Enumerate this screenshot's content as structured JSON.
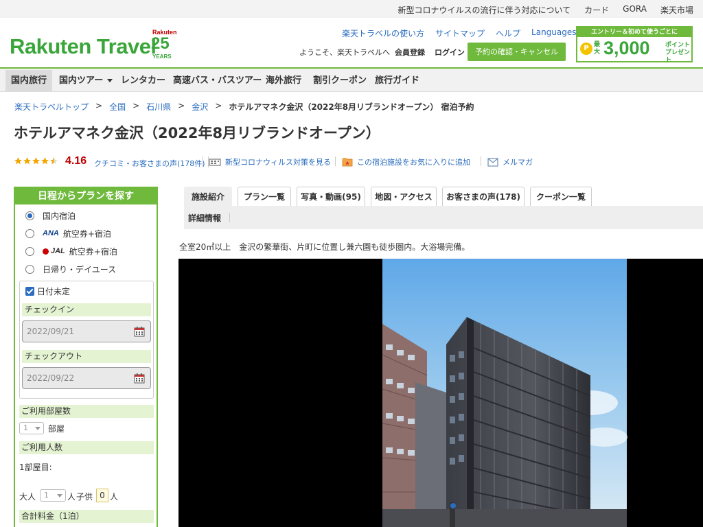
{
  "topbar": {
    "links": [
      "新型コロナウイルスの流行に伴う対応について",
      "カード",
      "GORA",
      "楽天市場"
    ]
  },
  "header": {
    "logo_text": "Rakuten Travel",
    "anniv_brand": "Rakuten",
    "anniv_number": "25",
    "anniv_years": "YEARS",
    "links": [
      "楽天トラベルの使い方",
      "サイトマップ",
      "ヘルプ",
      "Languages"
    ],
    "welcome": "ようこそ、楽天トラベルへ",
    "member_register": "会員登録",
    "login": "ログイン",
    "reserve_button": "予約の確認・キャンセル",
    "promo": {
      "headline": "エントリー＆初めて使うごとに",
      "coin": "P",
      "max": "最大",
      "amount": "3,000",
      "unit": "ポイントプレゼント"
    }
  },
  "nav": {
    "items": [
      "国内旅行",
      "国内ツアー",
      "レンタカー",
      "高速バス・バスツアー",
      "海外旅行",
      "割引クーポン",
      "旅行ガイド"
    ],
    "active": "国内旅行"
  },
  "breadcrumb": {
    "items": [
      "楽天トラベルトップ",
      "全国",
      "石川県",
      "金沢"
    ],
    "separator": ">",
    "current": "ホテルアマネク金沢（2022年8月リブランドオープン） 宿泊予約"
  },
  "hotel": {
    "title": "ホテルアマネク金沢（2022年8月リブランドオープン）",
    "rating": "4.16",
    "rating_value": 4.16,
    "reviews_link": "クチコミ・お客さまの声(178件)",
    "covid_link": "新型コロナウィルス対策を見る",
    "favorite_link": "この宿泊施設をお気に入りに追加",
    "mail_link": "メルマガ",
    "description": "全室20㎡以上　金沢の繁華街、片町に位置し兼六園も徒歩圏内。大浴場完備。"
  },
  "sidebar": {
    "header": "日程からプランを探す",
    "options": [
      {
        "airline": "",
        "label": "国内宿泊",
        "selected": true
      },
      {
        "airline": "ANA",
        "label": "航空券+宿泊",
        "selected": false
      },
      {
        "airline": "JAL",
        "label": "航空券+宿泊",
        "selected": false
      },
      {
        "airline": "",
        "label": "日帰り・デイユース",
        "selected": false
      }
    ],
    "date_undecided": "日付未定",
    "checkin_label": "チェックイン",
    "checkin_value": "2022/09/21",
    "checkout_label": "チェックアウト",
    "checkout_value": "2022/09/22",
    "rooms_label": "ご利用部屋数",
    "rooms_value": "1",
    "rooms_unit": "部屋",
    "guests_label": "ご利用人数",
    "room1_label": "1部屋目:",
    "adult_label": "大人",
    "adult_value": "1",
    "adult_unit": "人",
    "child_label": "子供",
    "child_value": "0",
    "child_unit": "人",
    "total_label": "合計料金（1泊）"
  },
  "tabs": {
    "items": [
      "施設紹介",
      "プラン一覧",
      "写真・動画(95)",
      "地図・アクセス",
      "お客さまの声(178)",
      "クーポン一覧"
    ],
    "active": "施設紹介",
    "subtab": "詳細情報"
  },
  "colors": {
    "brand_green": "#6fb93c",
    "link_blue": "#2a6cbf",
    "rating_red": "#bf0000"
  }
}
